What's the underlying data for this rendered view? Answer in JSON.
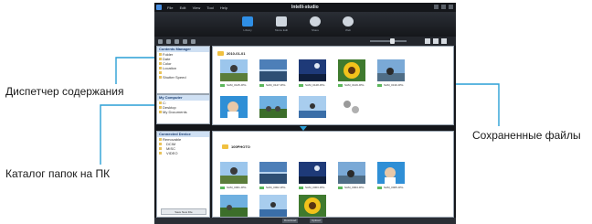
{
  "callouts": {
    "content_manager": "Диспетчер содержания",
    "pc_folders": "Каталог папок на ПК",
    "saved_files": "Сохраненные файлы"
  },
  "app": {
    "title": "Intelli-studio",
    "menu": [
      "File",
      "Edit",
      "View",
      "Tool",
      "Help"
    ],
    "modes": [
      {
        "label": "Library",
        "icon": "library-icon",
        "active": true
      },
      {
        "label": "Movie Edit",
        "icon": "movie-edit-icon",
        "active": false
      },
      {
        "label": "Share",
        "icon": "share-icon",
        "active": false
      },
      {
        "label": "Web",
        "icon": "globe-icon",
        "active": false
      }
    ]
  },
  "content_manager": {
    "title": "Contents Manager",
    "items": [
      "Folder",
      "Date",
      "Color",
      "Location",
      "",
      "Shutter Speed"
    ]
  },
  "my_computer": {
    "title": "My Computer",
    "items": [
      "C:",
      "Desktop",
      "My Documents"
    ]
  },
  "top_group": {
    "title": "2010-01-01",
    "files": [
      "SAM_0125.JPG",
      "SAM_0127.JPG",
      "SAM_0128.JPG",
      "SAM_0129.JPG",
      "SAM_0130.JPG"
    ]
  },
  "device_panel": {
    "title": "Connected Device",
    "items": [
      "Removable",
      "DCIM",
      "MISC",
      "VIDEO"
    ],
    "save_button": "Save New File"
  },
  "bottom_group": {
    "title": "100PHOTO",
    "files": [
      "SAM_0001.JPG",
      "SAM_0002.JPG",
      "SAM_0003.JPG",
      "SAM_0004.JPG",
      "SAM_0005.JPG"
    ]
  },
  "status_bar": {
    "download_label": "Download",
    "upload_label": "Upload"
  },
  "colors": {
    "accent": "#2a9fd6",
    "window_bg": "#14161a",
    "panel_border": "#9aa5b1"
  }
}
